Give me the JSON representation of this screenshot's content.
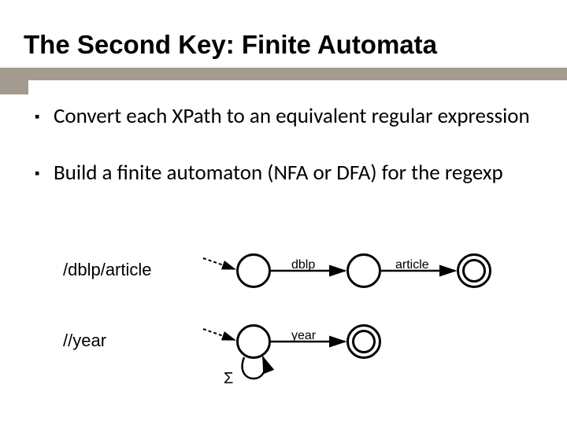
{
  "title": "The Second Key: Finite Automata",
  "bullets": [
    "Convert each XPath to an equivalent regular expression",
    "Build a finite automaton (NFA or DFA) for the regexp"
  ],
  "automata": [
    {
      "path": "/dblp/article",
      "edges": [
        "dblp",
        "article"
      ]
    },
    {
      "path": "//year",
      "edges": [
        "year"
      ],
      "self_loop": "Σ"
    }
  ]
}
